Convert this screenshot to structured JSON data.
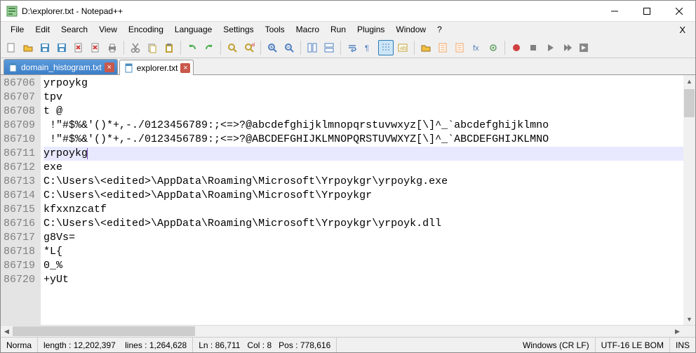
{
  "window": {
    "title": "D:\\explorer.txt - Notepad++"
  },
  "menu": {
    "items": [
      "File",
      "Edit",
      "Search",
      "View",
      "Encoding",
      "Language",
      "Settings",
      "Tools",
      "Macro",
      "Run",
      "Plugins",
      "Window",
      "?"
    ]
  },
  "toolbar": {
    "groups": [
      [
        "new-file",
        "open-file",
        "save",
        "save-all",
        "close",
        "close-all",
        "print"
      ],
      [
        "cut",
        "copy",
        "paste"
      ],
      [
        "undo",
        "redo"
      ],
      [
        "find",
        "replace"
      ],
      [
        "zoom-in",
        "zoom-out"
      ],
      [
        "sync-v",
        "sync-h"
      ],
      [
        "word-wrap",
        "show-all",
        "indent-guide",
        "user-lang"
      ],
      [
        "folder-explorer",
        "doc-map",
        "doc-list",
        "function-list",
        "monitoring"
      ],
      [
        "record-macro",
        "stop-macro",
        "play-macro",
        "play-multi",
        "save-macro"
      ]
    ],
    "active": [
      "indent-guide"
    ]
  },
  "tabs": [
    {
      "label": "domain_histogram.txt",
      "active": false
    },
    {
      "label": "explorer.txt",
      "active": true
    }
  ],
  "editor": {
    "first_line_number": 86706,
    "current_line_index": 5,
    "lines": [
      "yrpoykg",
      "tpv",
      "t @",
      " !\"#$%&'()*+,-./0123456789:;<=>?@abcdefghijklmnopqrstuvwxyz[\\]^_`abcdefghijklmno",
      " !\"#$%&'()*+,-./0123456789:;<=>?@ABCDEFGHIJKLMNOPQRSTUVWXYZ[\\]^_`ABCDEFGHIJKLMNO",
      "yrpoykg",
      "exe",
      "C:\\Users\\<edited>\\AppData\\Roaming\\Microsoft\\Yrpoykgr\\yrpoykg.exe",
      "C:\\Users\\<edited>\\AppData\\Roaming\\Microsoft\\Yrpoykgr",
      "kfxxnzcatf",
      "C:\\Users\\<edited>\\AppData\\Roaming\\Microsoft\\Yrpoykgr\\yrpoyk.dll",
      "g8Vs=",
      "*L{",
      "0_%",
      "+yUt"
    ]
  },
  "status": {
    "doc_type": "Norma",
    "length_label": "length :",
    "length": "12,202,397",
    "lines_label": "lines :",
    "lines": "1,264,628",
    "ln_label": "Ln :",
    "ln": "86,711",
    "col_label": "Col :",
    "col": "8",
    "pos_label": "Pos :",
    "pos": "778,616",
    "eol": "Windows (CR LF)",
    "encoding": "UTF-16 LE BOM",
    "mode": "INS"
  },
  "icon_colors": {
    "new": "#f5f5f0",
    "open": "#f0c040",
    "save": "#4a8ec0",
    "print": "#888",
    "cut": "#888",
    "copy": "#c0a030",
    "paste": "#c0a030",
    "undo": "#4caf50",
    "redo": "#4caf50",
    "find": "#c0a030",
    "zoom": "#5080c0",
    "record": "#d04040"
  }
}
